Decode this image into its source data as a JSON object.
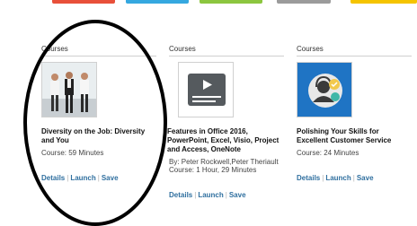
{
  "accent_colors": {
    "topbar": [
      "#e8503a",
      "#35a8e0",
      "#8cc63f",
      "#9b9b9b",
      "#f5c400"
    ],
    "link": "#2f6f9f",
    "annotation": "#000000"
  },
  "cards": [
    {
      "section_label": "Courses",
      "thumbnail_icon": "business-people-photo",
      "title_lines": [
        "Diversity on the Job: Diversity",
        "and You"
      ],
      "meta_lines": [
        "Course: 59 Minutes"
      ],
      "actions": [
        "Details",
        "Launch",
        "Save"
      ]
    },
    {
      "section_label": "Courses",
      "thumbnail_icon": "video-presentation-icon",
      "title_lines": [
        "Features in Office 2016,",
        "PowerPoint, Excel, Visio, Project",
        "and Access, OneNote"
      ],
      "meta_lines": [
        "By: Peter Rockwell,Peter Theriault",
        "Course: 1 Hour, 29 Minutes"
      ],
      "actions": [
        "Details",
        "Launch",
        "Save"
      ]
    },
    {
      "section_label": "Courses",
      "thumbnail_icon": "customer-service-headset-icon",
      "title_lines": [
        "Polishing Your Skills for",
        "Excellent Customer Service"
      ],
      "meta_lines": [
        "Course: 24 Minutes"
      ],
      "actions": [
        "Details",
        "Launch",
        "Save"
      ]
    }
  ]
}
